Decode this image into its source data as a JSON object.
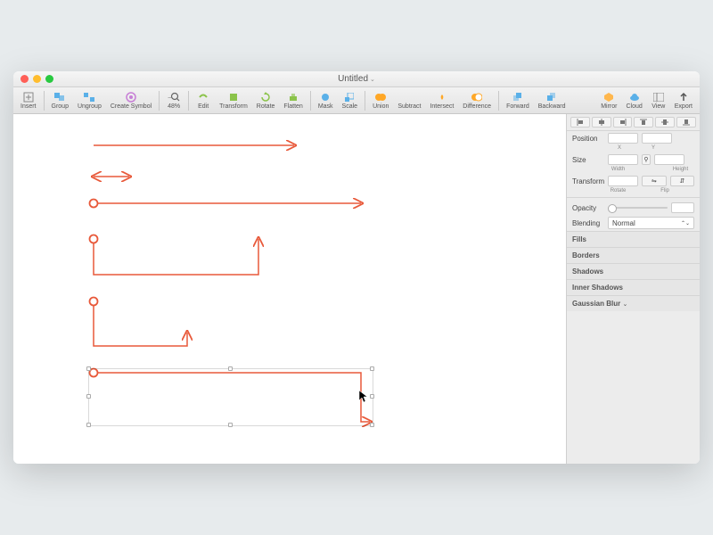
{
  "window": {
    "title": "Untitled"
  },
  "traffic": {
    "close": "#ff5f57",
    "min": "#ffbd2e",
    "max": "#28c940"
  },
  "toolbar": {
    "insert": "Insert",
    "group": "Group",
    "ungroup": "Ungroup",
    "createSymbol": "Create Symbol",
    "zoom": "48%",
    "edit": "Edit",
    "transform": "Transform",
    "rotate": "Rotate",
    "flatten": "Flatten",
    "mask": "Mask",
    "scale": "Scale",
    "union": "Union",
    "subtract": "Subtract",
    "intersect": "Intersect",
    "difference": "Difference",
    "forward": "Forward",
    "backward": "Backward",
    "mirror": "Mirror",
    "cloud": "Cloud",
    "view": "View",
    "export": "Export"
  },
  "inspector": {
    "position": "Position",
    "x": "X",
    "y": "Y",
    "size": "Size",
    "width": "Width",
    "height": "Height",
    "transform": "Transform",
    "rotate": "Rotate",
    "flip": "Flip",
    "opacity": "Opacity",
    "blending": "Blending",
    "blendingValue": "Normal",
    "fills": "Fills",
    "borders": "Borders",
    "shadows": "Shadows",
    "innerShadows": "Inner Shadows",
    "gaussianBlur": "Gaussian Blur"
  },
  "colors": {
    "arrow": "#e8593a",
    "iconBlue": "#5ab0e8",
    "iconGreen": "#8bc34a",
    "iconOrange": "#ffa726",
    "iconDiamond": "#ffb74d"
  }
}
